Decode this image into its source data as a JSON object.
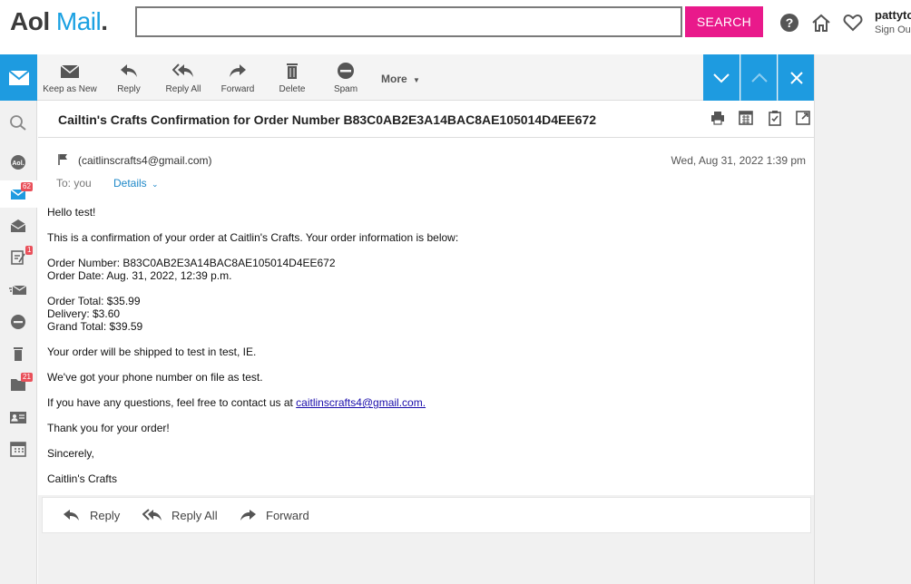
{
  "header": {
    "logo_aol": "Aol",
    "logo_mail": "Mail",
    "logo_dot": ".",
    "search_placeholder": "",
    "search_button": "SEARCH",
    "user_name": "pattyto",
    "sign_out": "Sign Ou"
  },
  "toolbar": {
    "keep_as_new": "Keep as New",
    "reply": "Reply",
    "reply_all": "Reply All",
    "forward": "Forward",
    "delete": "Delete",
    "spam": "Spam",
    "more": "More"
  },
  "sidebar": {
    "inbox_badge": "62",
    "drafts_badge": "1",
    "folders_badge": "21"
  },
  "message": {
    "subject": "Cailtin's Crafts Confirmation for Order Number B83C0AB2E3A14BAC8AE105014D4EE672",
    "from": "(caitlinscrafts4@gmail.com)",
    "date": "Wed, Aug 31, 2022 1:39 pm",
    "to": "To: you",
    "details": "Details",
    "greeting": "Hello test!",
    "intro": "This is a confirmation of your order at Caitlin's Crafts. Your order information is below:",
    "order_number": "Order Number: B83C0AB2E3A14BAC8AE105014D4EE672",
    "order_date": "Order Date: Aug. 31, 2022, 12:39 p.m.",
    "order_total": "Order Total: $35.99",
    "delivery": "Delivery: $3.60",
    "grand_total": "Grand Total: $39.59",
    "shipping": "Your order will be shipped to test in test, IE.",
    "phone": "We've got your phone number on file as test.",
    "questions_prefix": "If you have any questions, feel free to contact us at ",
    "contact_email": "caitlinscrafts4@gmail.com.",
    "thanks": "Thank you for your order!",
    "sincerely": "Sincerely,",
    "signature": "Caitlin's Crafts"
  },
  "reply_bar": {
    "reply": "Reply",
    "reply_all": "Reply All",
    "forward": "Forward"
  },
  "colors": {
    "brand_blue": "#1e9be0",
    "search_pink": "#e9198b",
    "badge_red": "#e9505a"
  }
}
